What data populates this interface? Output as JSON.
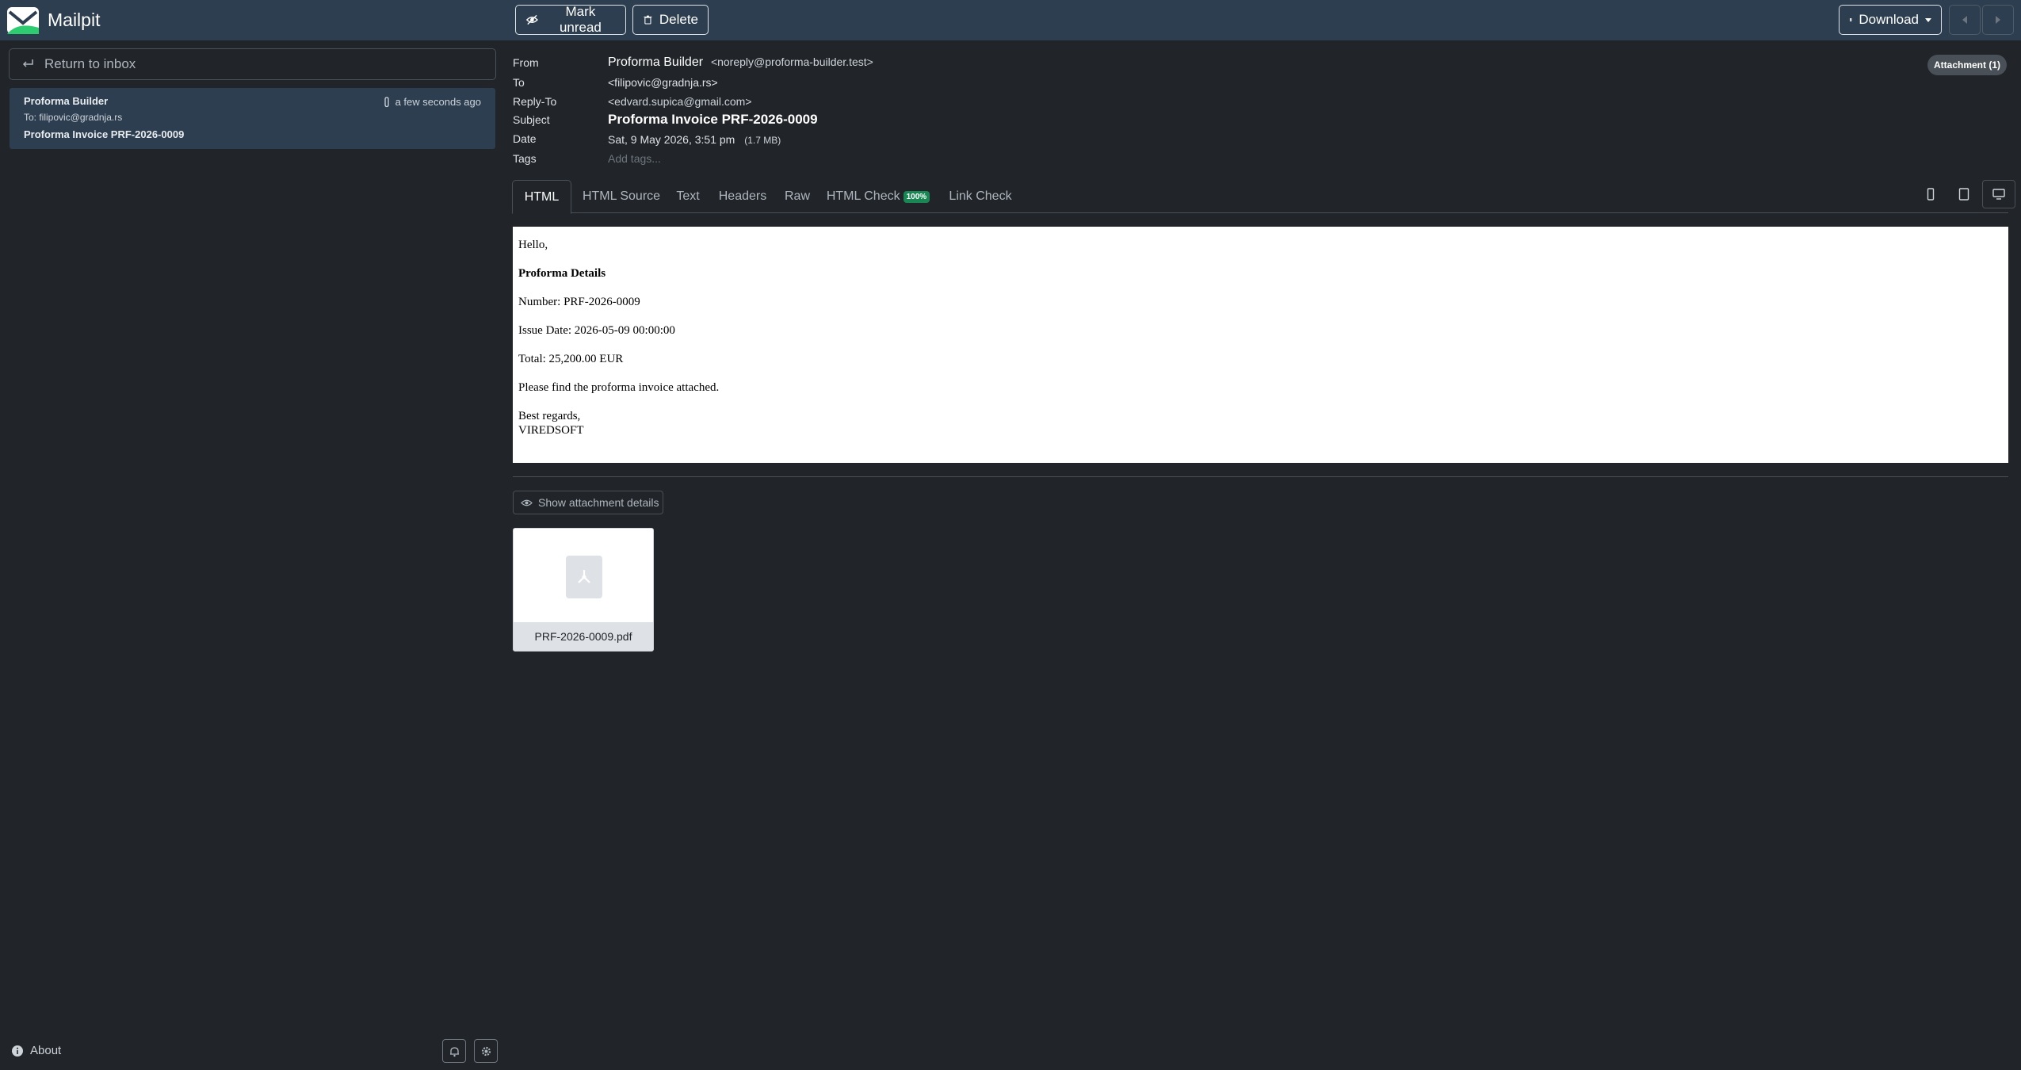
{
  "app": {
    "name": "Mailpit"
  },
  "toolbar": {
    "mark_unread": "Mark unread",
    "delete": "Delete",
    "download": "Download"
  },
  "sidebar": {
    "return_label": "Return to inbox",
    "message": {
      "from": "Proforma Builder",
      "time": "a few seconds ago",
      "to": "To: filipovic@gradnja.rs",
      "subject": "Proforma Invoice PRF-2026-0009"
    },
    "about": "About"
  },
  "headers": {
    "from_label": "From",
    "from_name": "Proforma Builder",
    "from_email": "<noreply@proforma-builder.test>",
    "to_label": "To",
    "to_value": "<filipovic@gradnja.rs>",
    "reply_to_label": "Reply-To",
    "reply_to_value": "<edvard.supica@gmail.com>",
    "subject_label": "Subject",
    "subject_value": "Proforma Invoice PRF-2026-0009",
    "date_label": "Date",
    "date_value": "Sat, 9 May 2026, 3:51 pm",
    "size": "(1.7 MB)",
    "tags_label": "Tags",
    "tags_placeholder": "Add tags...",
    "attachment_badge": "Attachment (1)"
  },
  "tabs": [
    {
      "label": "HTML",
      "active": true
    },
    {
      "label": "HTML Source"
    },
    {
      "label": "Text"
    },
    {
      "label": "Headers"
    },
    {
      "label": "Raw"
    },
    {
      "label": "HTML Check",
      "badge": "100%"
    },
    {
      "label": "Link Check"
    }
  ],
  "email_body": {
    "greeting": "Hello,",
    "heading": "Proforma Details",
    "number": "Number: PRF-2026-0009",
    "issue_date": "Issue Date: 2026-05-09 00:00:00",
    "total": "Total: 25,200.00 EUR",
    "note": "Please find the proforma invoice attached.",
    "closing": "Best regards,",
    "signature": "VIREDSOFT"
  },
  "attachments": {
    "show_details": "Show attachment details",
    "file_name": "PRF-2026-0009.pdf"
  },
  "colors": {
    "topbar": "#2c3e50",
    "background": "#212529",
    "brand_green": "#2ecc71",
    "badge_green": "#198754"
  }
}
